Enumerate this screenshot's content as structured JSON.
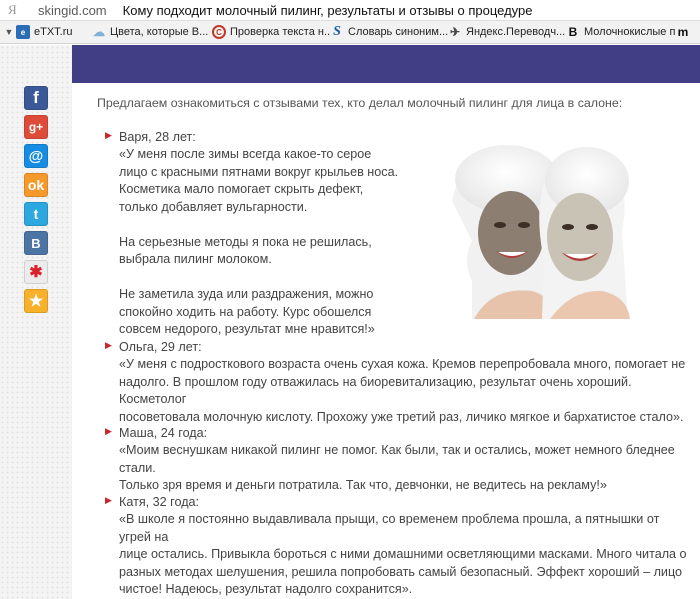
{
  "address_bar": {
    "logo": "Я",
    "domain": "skingid.com",
    "page_title": "Кому подходит молочный пилинг, результаты и отзывы о процедуре"
  },
  "bookmarks": {
    "items": [
      {
        "label": "eTXT.ru",
        "icon": "etxt-icon"
      },
      {
        "label": "Цвета, которые В...",
        "icon": "cloud-icon"
      },
      {
        "label": "Проверка текста н...",
        "icon": "copyright-icon"
      },
      {
        "label": "Словарь синоним...",
        "icon": "s-logo-icon"
      },
      {
        "label": "Яндекс.Переводч...",
        "icon": "yandex-translate-icon"
      },
      {
        "label": "Молочнокислые п...",
        "icon": "b-logo-icon"
      },
      {
        "label": "",
        "icon": "m-logo-icon"
      }
    ]
  },
  "social": [
    "facebook-icon",
    "google-plus-icon",
    "mail-icon",
    "odnoklassniki-icon",
    "twitter-icon",
    "vk-icon",
    "liveinternet-icon",
    "favorites-icon"
  ],
  "content": {
    "intro": "Предлагаем ознакомиться с отзывами тех, кто делал молочный пилинг для лица в салоне:",
    "reviews": [
      {
        "name": "Варя, 28 лет:",
        "text": "«У меня после зимы всегда какое-то серое\nлицо с красными пятнами вокруг крыльев носа.\nКосметика мало помогает скрыть дефект,\nтолько добавляет вульгарности.\n\nНа серьезные методы я пока не решилась,\nвыбрала пилинг молоком.\n\nНе заметила зуда или раздражения, можно\nспокойно ходить на работу. Курс обошелся\nсовсем недорого, результат мне нравится!»"
      },
      {
        "name": "Ольга, 29 лет:",
        "text": "«У меня с подросткового возраста очень сухая кожа. Кремов перепробовала много, помогает не\nнадолго. В прошлом году отважилась на биоревитализацию, результат очень хороший. Косметолог\nпосоветовала молочную кислоту. Прохожу уже третий раз, личико мягкое и бархатистое стало»."
      },
      {
        "name": "Маша, 24 года:",
        "text": "«Моим веснушкам никакой пилинг не помог. Как были, так и остались, может немного бледнее стали.\nТолько зря время и деньги потратила. Так что, девчонки, не ведитесь на рекламу!»"
      },
      {
        "name": "Катя, 32 года:",
        "text": "«В школе я постоянно выдавливала прыщи, со временем проблема прошла, а пятнышки от угрей на\nлице остались. Привыкла бороться с ними домашними осветляющими масками. Много читала о\nразных методах шелушения, решила попробовать самый безопасный. Эффект хороший – лицо\nчистое! Надеюсь, результат надолго сохранится»."
      }
    ]
  },
  "colors": {
    "banner": "#413e86",
    "bullet": "#c8262d"
  }
}
